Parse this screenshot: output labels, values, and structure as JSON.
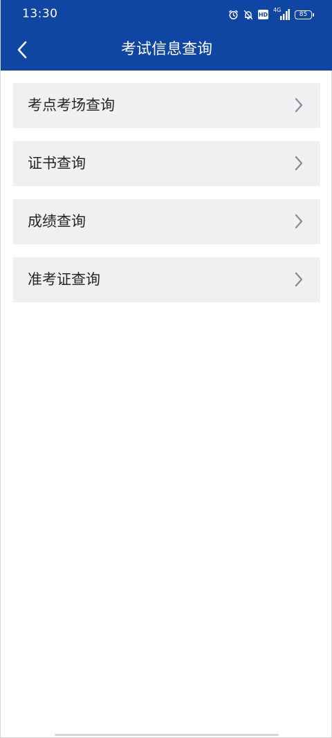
{
  "status_bar": {
    "time": "13:30",
    "hd_label": "HD",
    "network_label": "4G",
    "battery_level": "85",
    "icons": [
      "alarm-icon",
      "bell-off-icon",
      "hd-icon",
      "signal-icon",
      "battery-icon"
    ]
  },
  "header": {
    "title": "考试信息查询",
    "back_icon": "chevron-left-icon",
    "background_color": "#0f46a3"
  },
  "menu": {
    "items": [
      {
        "label": "考点考场查询",
        "icon": "chevron-right-icon"
      },
      {
        "label": "证书查询",
        "icon": "chevron-right-icon"
      },
      {
        "label": "成绩查询",
        "icon": "chevron-right-icon"
      },
      {
        "label": "准考证查询",
        "icon": "chevron-right-icon"
      }
    ],
    "item_background": "#f0f0f2"
  }
}
